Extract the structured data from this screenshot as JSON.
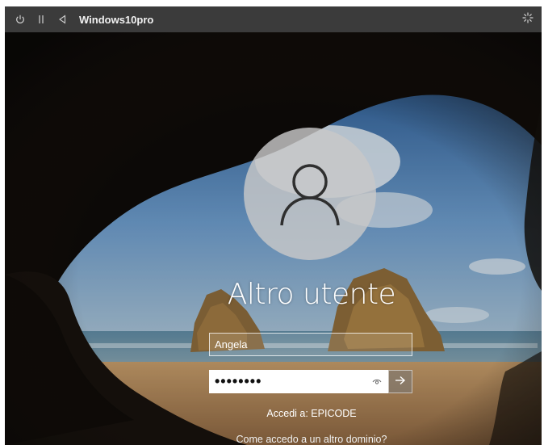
{
  "window": {
    "title": "Windows10pro",
    "controls": {
      "power_icon": "power-icon",
      "pause_icon": "pause-icon",
      "back_icon": "back-icon",
      "status_icon": "loading-icon"
    }
  },
  "login": {
    "avatar_icon": "user-icon",
    "user_display_name": "Altro utente",
    "username_value": "Angela",
    "password_mask": "••••••••",
    "reveal_icon": "eye-icon",
    "submit_icon": "arrow-right-icon",
    "sign_in_to": "Accedi a: EPICODE",
    "other_domain_link": "Come accedo a un altro dominio?"
  },
  "colors": {
    "topbar_bg": "#3b3b3b",
    "text": "#ffffff",
    "sky": "#3b6ea3",
    "sand": "#b28a5c"
  }
}
